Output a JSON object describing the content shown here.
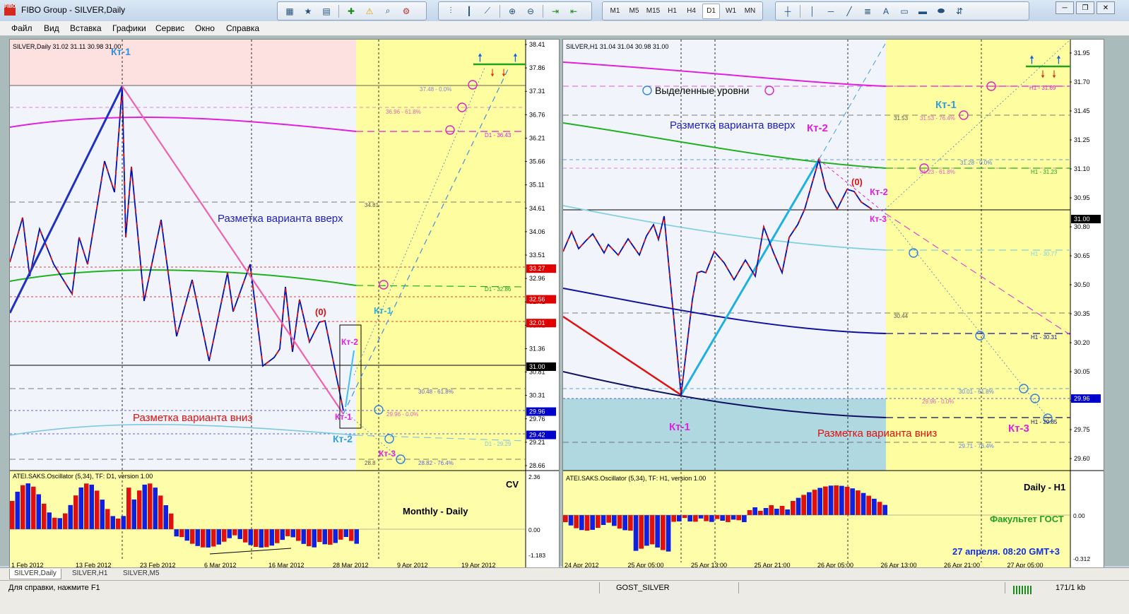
{
  "window": {
    "title": "FIBO Group - SILVER,Daily",
    "icon_text": "FIBO"
  },
  "menu": [
    "Файл",
    "Вид",
    "Вставка",
    "Графики",
    "Сервис",
    "Окно",
    "Справка"
  ],
  "toolbar": {
    "timeframes": [
      "M1",
      "M5",
      "M15",
      "H1",
      "H4",
      "D1",
      "W1",
      "MN"
    ],
    "active_timeframe": "D1",
    "text_tool": "A"
  },
  "left_chart": {
    "header": "SILVER,Daily  31.02 31.11 30.98 31.00",
    "price_ticks": [
      "38.41",
      "37.86",
      "37.31",
      "36.76",
      "36.21",
      "35.66",
      "35.11",
      "34.61",
      "34.06",
      "33.51",
      "32.96",
      "32.41",
      "31.91",
      "31.36",
      "30.81",
      "30.31",
      "29.76",
      "29.21",
      "28.66"
    ],
    "price_tags": [
      {
        "v": "33.27",
        "c": "#e00000"
      },
      {
        "v": "32.56",
        "c": "#e00000"
      },
      {
        "v": "32.01",
        "c": "#e00000"
      },
      {
        "v": "31.00",
        "c": "#000000"
      },
      {
        "v": "29.96",
        "c": "#0000cc"
      },
      {
        "v": "29.42",
        "c": "#0000cc"
      }
    ],
    "date_ticks": [
      "1 Feb 2012",
      "13 Feb 2012",
      "23 Feb 2012",
      "6 Mar 2012",
      "16 Mar 2012",
      "28 Mar 2012",
      "9 Apr 2012",
      "19 Apr 2012"
    ],
    "labels": {
      "kt1_top": "Кт-1",
      "up_variant": "Разметка варианта вверх",
      "down_variant": "Разметка варианта вниз",
      "zero": "(0)",
      "kt2_m": "Кт-2",
      "kt1_m": "Кт-1",
      "kt1_c": "Кт-1",
      "kt2_c": "Кт-2",
      "kt3_m": "Кт-3"
    },
    "level_labels": [
      "37.48 - 0.0%",
      "36.96 - 61.8%",
      "D1 - 36.43",
      "34.81",
      "D1 - 32.86",
      "30.48 - 61.8%",
      "29.96 - 0.0%",
      "D1 - 29.29",
      "28.82 - 76.4%",
      "28.8"
    ],
    "oscillator": {
      "header": "ATEI.SAKS.Oscillator (5,34), TF: D1, version 1.00",
      "ticks": [
        "2.36",
        "0.00",
        "-1.183"
      ],
      "label_cv": "CV",
      "label_period": "Monthly - Daily"
    }
  },
  "right_chart": {
    "header": "SILVER,H1  31.04 31.04 30.98 31.00",
    "price_ticks": [
      "31.95",
      "31.70",
      "31.45",
      "31.25",
      "31.10",
      "30.95",
      "30.80",
      "30.65",
      "30.50",
      "30.35",
      "30.20",
      "30.05",
      "29.90",
      "29.75",
      "29.60"
    ],
    "price_tags": [
      {
        "v": "31.00",
        "c": "#000000"
      },
      {
        "v": "29.96",
        "c": "#0000cc"
      }
    ],
    "date_ticks": [
      "24 Apr 2012",
      "25 Apr 05:00",
      "25 Apr 13:00",
      "25 Apr 21:00",
      "26 Apr 05:00",
      "26 Apr 13:00",
      "26 Apr 21:00",
      "27 Apr 05:00"
    ],
    "labels": {
      "legend": "Выделенные уровни",
      "up_variant": "Разметка варианта вверх",
      "kt2_top": "Кт-2",
      "kt1_right": "Кт-1",
      "zero": "(0)",
      "kt2_m": "Кт-2",
      "kt3_overlap": "Кт-3",
      "kt1_bottom": "Кт-1",
      "down_variant": "Разметка варианта вниз",
      "kt3_bottom": "Кт-3"
    },
    "level_labels": [
      "H1 - 31.69",
      "31.53",
      "31.53 - 76.4%",
      "31.28 - 0.0%",
      "31.23 - 61.8%",
      "H1 - 31.23",
      "H1 - 30.77",
      "30.44",
      "H1 - 30.31",
      "30.01 - 61.8%",
      "29.96 - 0.0%",
      "H1 - 29.85",
      "29.71 - 76.4%"
    ],
    "oscillator": {
      "header": "ATEI.SAKS.Oscillator (5,34), TF: H1, version 1.00",
      "ticks": [
        "0.00",
        "-0.312"
      ],
      "label_period": "Daily - H1",
      "label_faculty": "Факультет ГОСТ",
      "label_time": "27 апреля. 08:20 GMT+3"
    }
  },
  "tabs": [
    "SILVER,Daily",
    "SILVER,H1",
    "SILVER,M5"
  ],
  "status": {
    "help": "Для справки, нажмите F1",
    "profile": "GOST_SILVER",
    "traffic": "171/1 kb"
  }
}
